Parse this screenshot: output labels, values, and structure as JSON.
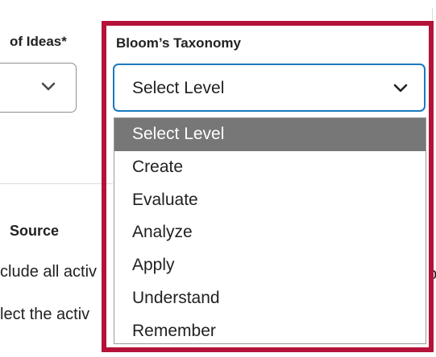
{
  "left": {
    "label": "of Ideas*",
    "source_label": "Source",
    "text_line1": "clude all activ",
    "text_line2": "lect the activ"
  },
  "right_fragment": "p",
  "bloom": {
    "label": "Bloom’s Taxonomy",
    "selected": "Select Level",
    "options": [
      {
        "label": "Select Level"
      },
      {
        "label": "Create"
      },
      {
        "label": "Evaluate"
      },
      {
        "label": "Analyze"
      },
      {
        "label": "Apply"
      },
      {
        "label": "Understand"
      },
      {
        "label": "Remember"
      }
    ]
  },
  "colors": {
    "highlight": "#b5123a",
    "focus_border": "#1c79bf",
    "selected_option_bg": "#777777"
  },
  "icons": {
    "select_chevron": "chevron-down-icon"
  }
}
